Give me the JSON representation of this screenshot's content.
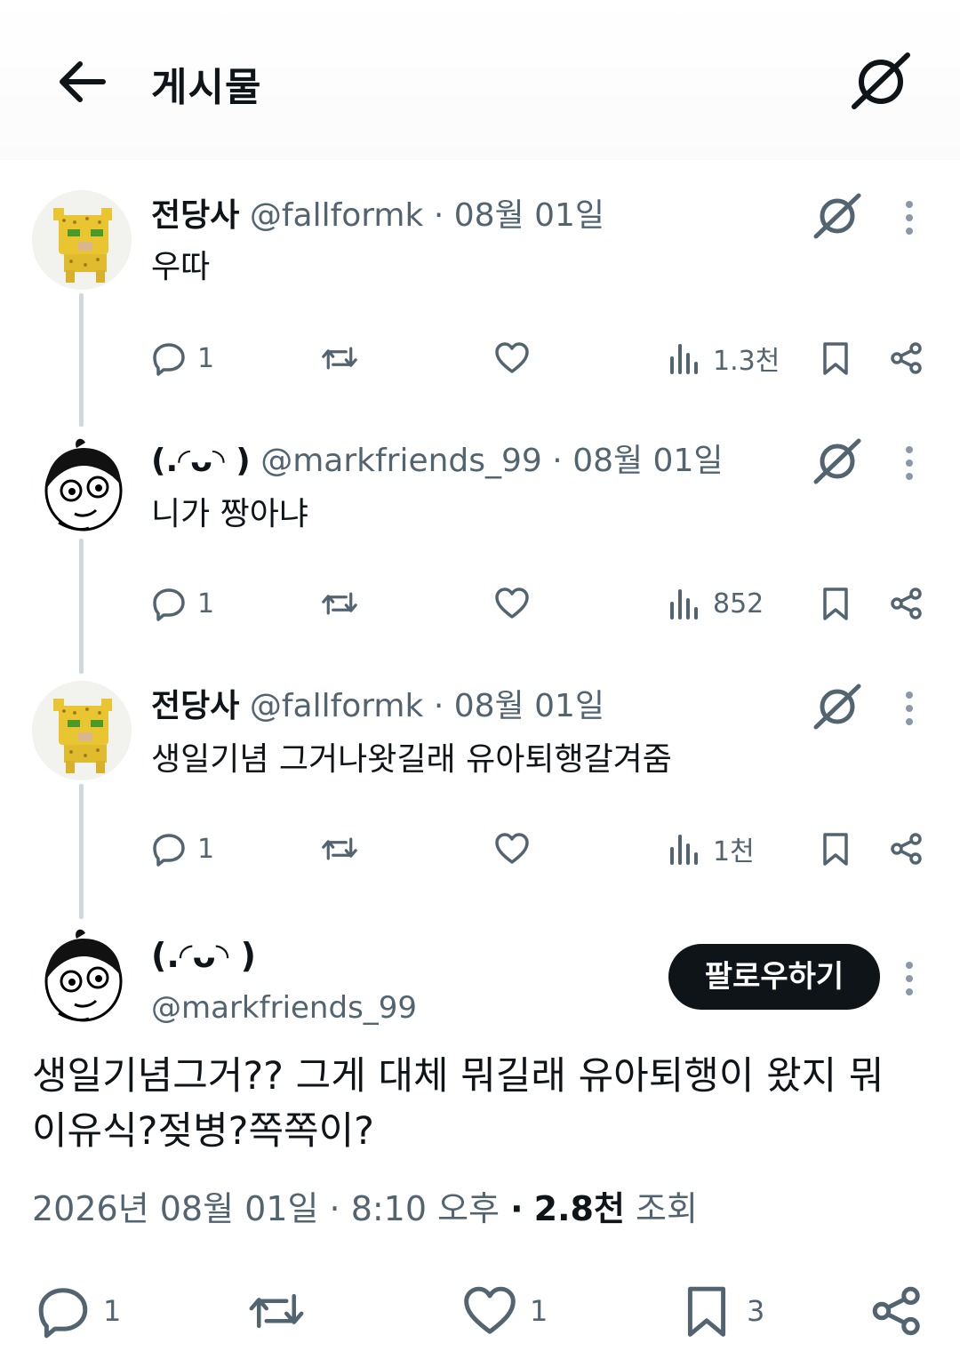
{
  "header": {
    "title": "게시물"
  },
  "tweets": [
    {
      "name": "전당사",
      "handle": "@fallformk",
      "dot": "·",
      "date": "08월 01일",
      "text": "우따",
      "replies": "1",
      "views": "1.3천"
    },
    {
      "name": "(.◜ᴗ◝ )",
      "handle": "@markfriends_99",
      "dot": "·",
      "date": "08월 01일",
      "text": "니가 짱아냐",
      "replies": "1",
      "views": "852"
    },
    {
      "name": "전당사",
      "handle": "@fallformk",
      "dot": "·",
      "date": "08월 01일",
      "text": "생일기념 그거나왓길래 유아퇴행갈겨줌",
      "replies": "1",
      "views": "1천"
    }
  ],
  "main": {
    "name": "(.◜ᴗ◝ )",
    "handle": "@markfriends_99",
    "follow_label": "팔로우하기",
    "text_line1": "생일기념그거?? 그게 대체 뭐길래 유아퇴행이 왔지 뭐",
    "text_line2": "이유식?젖병?쪽쪽이?",
    "timestamp": "2026년 08월 01일 · 8:10 오후",
    "sep": "·",
    "views": "2.8천",
    "views_label": "조회",
    "replies": "1",
    "likes": "1",
    "bookmarks": "3"
  },
  "icons": {
    "back": "arrow-left-icon",
    "grok": "grok-icon",
    "reply": "reply-icon",
    "retweet": "retweet-icon",
    "like": "heart-icon",
    "views": "views-icon",
    "bookmark": "bookmark-icon",
    "share": "share-icon",
    "more": "more-vertical-icon"
  },
  "colors": {
    "text": "#0f1419",
    "secondary": "#536471",
    "thread_line": "#cfd9de",
    "follow_button": "#0f1419"
  }
}
